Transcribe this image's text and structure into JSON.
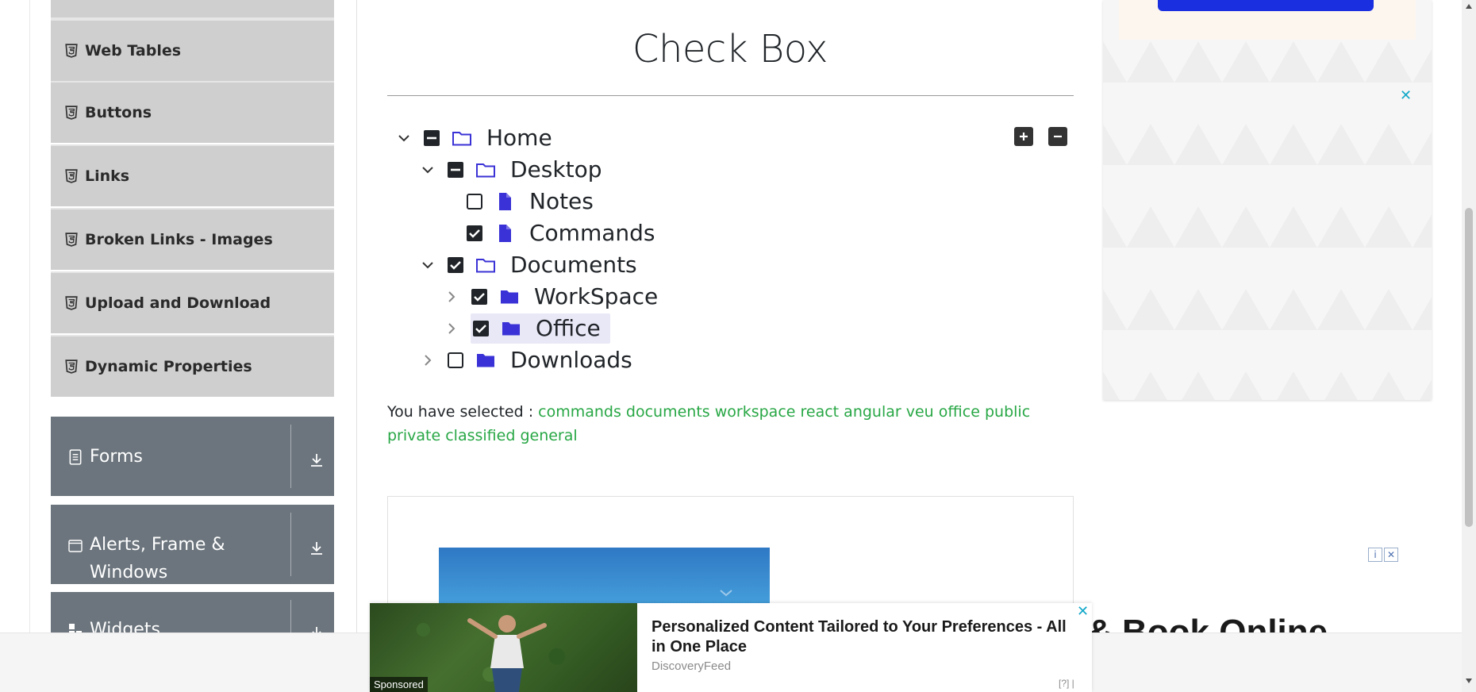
{
  "sidebar": {
    "items": [
      {
        "label": "Web Tables",
        "icon": "html5-icon"
      },
      {
        "label": "Buttons",
        "icon": "html5-icon"
      },
      {
        "label": "Links",
        "icon": "html5-icon"
      },
      {
        "label": "Broken Links - Images",
        "icon": "html5-icon"
      },
      {
        "label": "Upload and Download",
        "icon": "html5-icon"
      },
      {
        "label": "Dynamic Properties",
        "icon": "html5-icon"
      }
    ],
    "groups": [
      {
        "label": "Forms",
        "icon": "document-icon"
      },
      {
        "label_line1": "Alerts, Frame &",
        "label_line2": "Windows",
        "icon": "window-icon"
      },
      {
        "label": "Widgets",
        "icon": "widgets-icon"
      }
    ]
  },
  "main": {
    "title": "Check Box",
    "tree": [
      {
        "label": "Home",
        "state": "partial",
        "expanded": true
      },
      {
        "label": "Desktop",
        "state": "partial",
        "expanded": true
      },
      {
        "label": "Notes",
        "state": "unchecked"
      },
      {
        "label": "Commands",
        "state": "checked"
      },
      {
        "label": "Documents",
        "state": "checked",
        "expanded": true
      },
      {
        "label": "WorkSpace",
        "state": "checked",
        "expanded": false
      },
      {
        "label": "Office",
        "state": "checked",
        "expanded": false
      },
      {
        "label": "Downloads",
        "state": "unchecked",
        "expanded": false
      }
    ],
    "result_prefix": "You have selected :",
    "selected": [
      "commands",
      "documents",
      "workspace",
      "react",
      "angular",
      "veu",
      "office",
      "public",
      "private",
      "classified",
      "general"
    ]
  },
  "ads": {
    "right_close": "✕",
    "adchoice_info": "i",
    "adchoice_close": "✕",
    "bg_ad_text": "& Book Online",
    "sponsor": {
      "tag": "Sponsored",
      "title": "Personalized Content Tailored to Your Preferences - All in One Place",
      "source": "DiscoveryFeed",
      "help": "[?] |",
      "close": "✕"
    }
  },
  "colors": {
    "accent_green": "#28a745",
    "folder_blue": "#3a32d6",
    "group_gray": "#6c757d",
    "item_gray": "#cfcfcf"
  }
}
